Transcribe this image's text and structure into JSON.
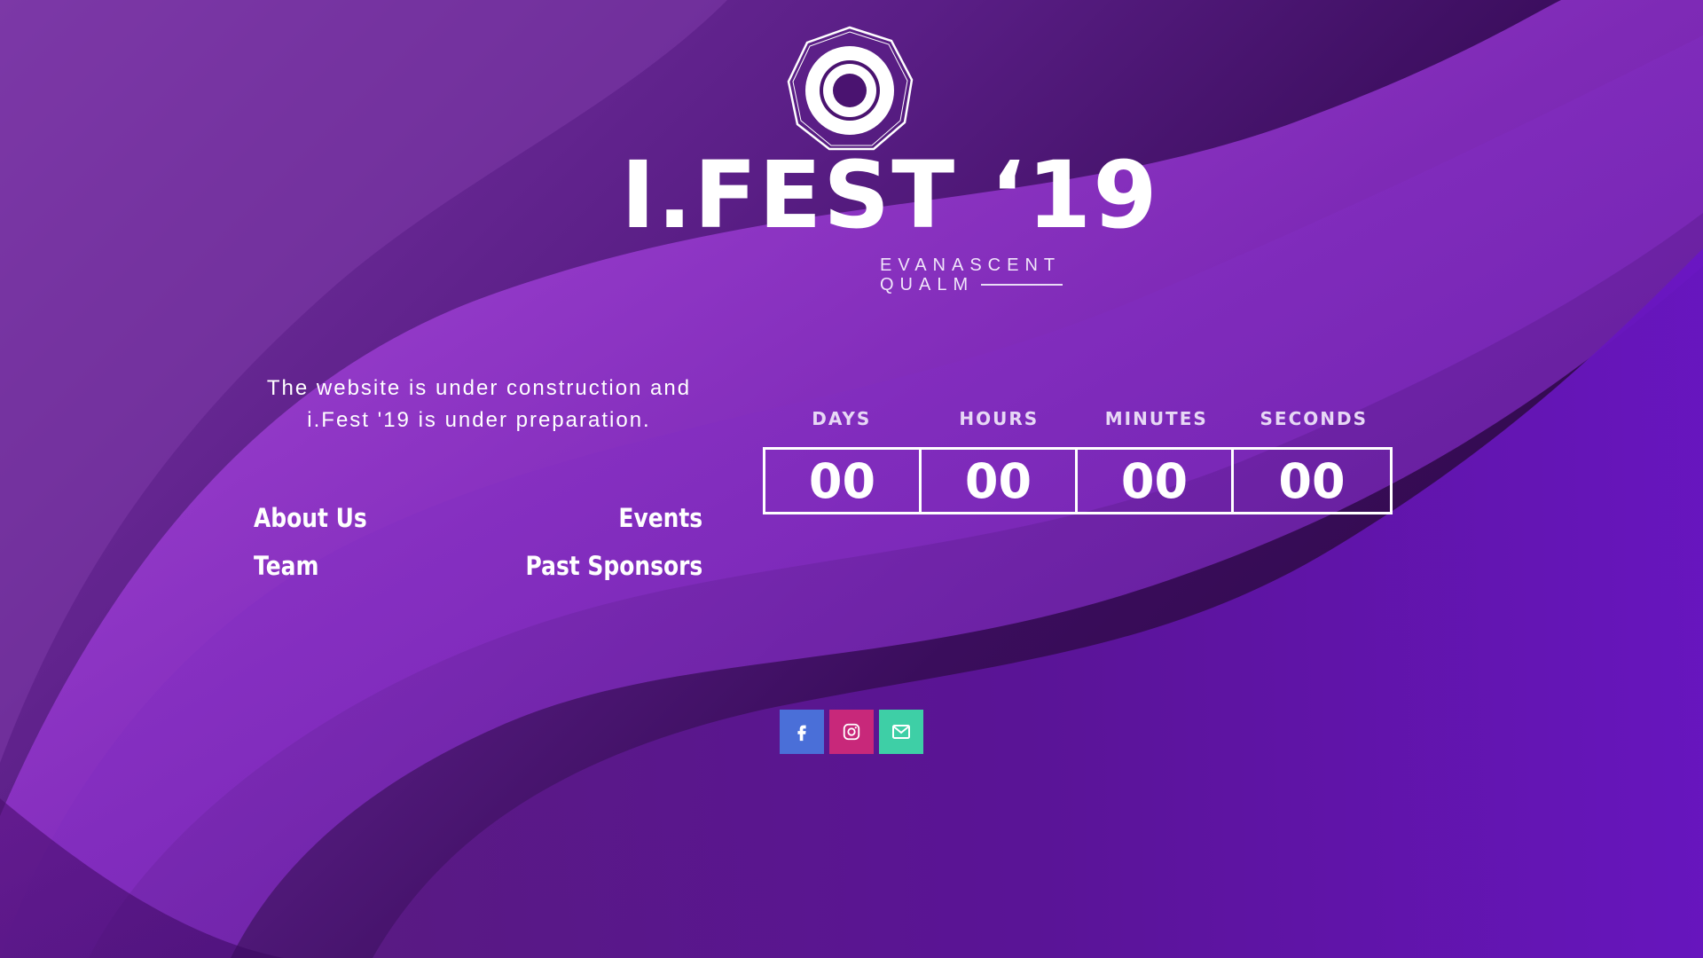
{
  "logo": {
    "title": "I.FEST ‘19",
    "subtitle_line1": "EVANASCENT",
    "subtitle_line2": "QUALM"
  },
  "notice": {
    "line1": "The website is under construction and",
    "line2": "i.Fest '19 is under preparation."
  },
  "nav": {
    "about": "About Us",
    "events": "Events",
    "team": "Team",
    "past_sponsors": "Past Sponsors"
  },
  "countdown": {
    "labels": [
      "DAYS",
      "HOURS",
      "MINUTES",
      "SECONDS"
    ],
    "values": [
      "00",
      "00",
      "00",
      "00"
    ]
  },
  "social": {
    "items": [
      {
        "name": "facebook",
        "icon": "facebook-icon",
        "color": "#4a6fd8"
      },
      {
        "name": "instagram",
        "icon": "instagram-icon",
        "color": "#c8287a"
      },
      {
        "name": "email",
        "icon": "mail-icon",
        "color": "#3ecfa6"
      }
    ]
  },
  "colors": {
    "background_dark": "#2a0740",
    "background_mid": "#5a1e86",
    "wave_light": "#9b3fd6",
    "wave_violet": "#6a19c2",
    "text": "#ffffff"
  }
}
